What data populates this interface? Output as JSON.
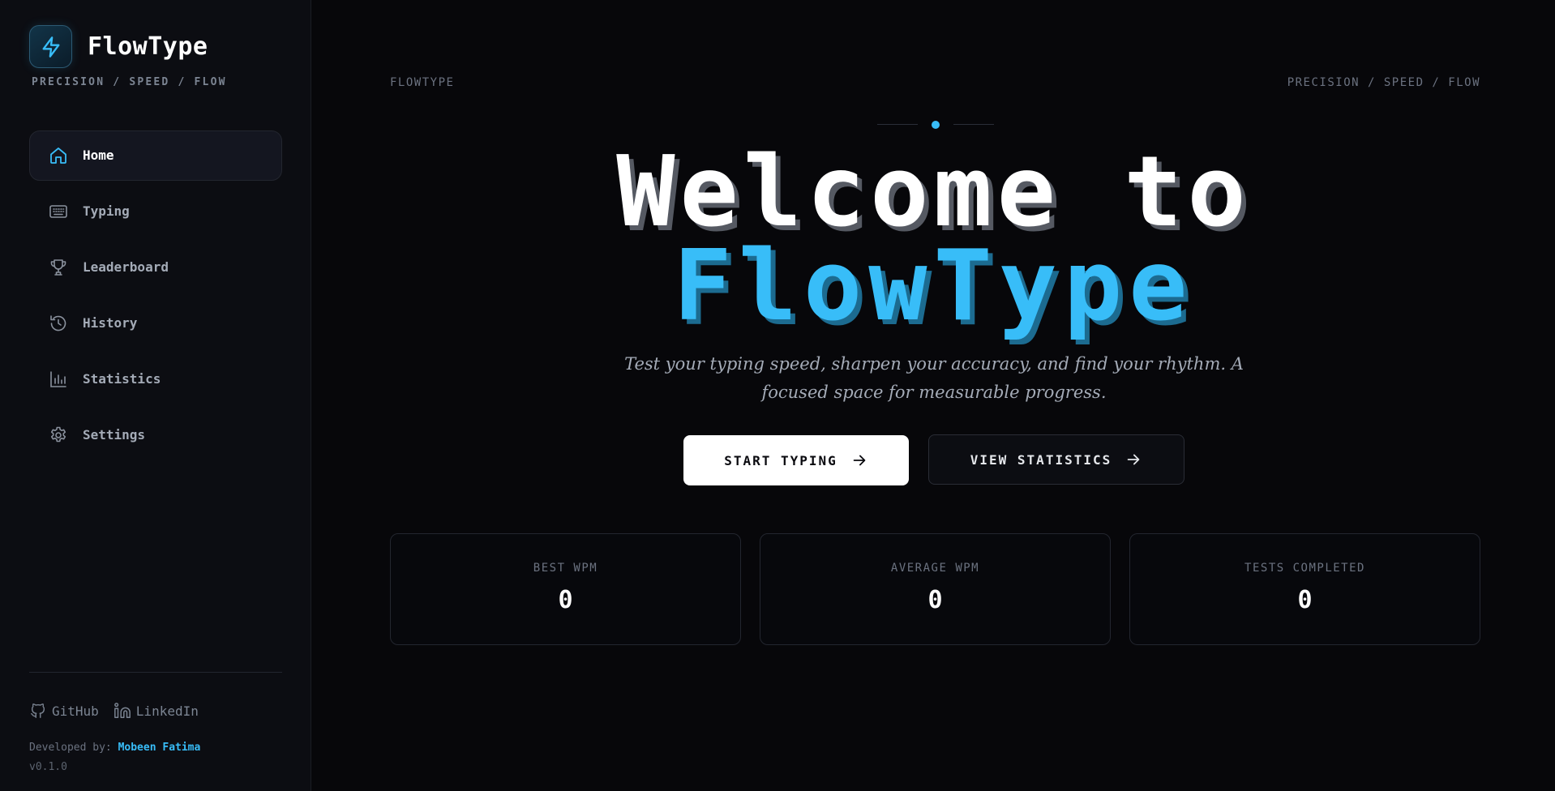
{
  "brand": {
    "name": "FlowType",
    "tagline": "PRECISION / SPEED / FLOW"
  },
  "sidebar": {
    "items": [
      {
        "label": "Home",
        "icon": "home-icon",
        "active": true
      },
      {
        "label": "Typing",
        "icon": "keyboard-icon",
        "active": false
      },
      {
        "label": "Leaderboard",
        "icon": "trophy-icon",
        "active": false
      },
      {
        "label": "History",
        "icon": "history-icon",
        "active": false
      },
      {
        "label": "Statistics",
        "icon": "bar-chart-icon",
        "active": false
      },
      {
        "label": "Settings",
        "icon": "gear-icon",
        "active": false
      }
    ],
    "socials": [
      {
        "label": "GitHub",
        "icon": "github-icon"
      },
      {
        "label": "LinkedIn",
        "icon": "linkedin-icon"
      }
    ],
    "developer_prefix": "Developed by:",
    "developer_name": "Mobeen Fatima",
    "version": "v0.1.0"
  },
  "main": {
    "top_left": "FLOWTYPE",
    "top_right": "PRECISION / SPEED / FLOW",
    "hero_line1": "Welcome to",
    "hero_line2": "FlowType",
    "subtitle": "Test your typing speed, sharpen your accuracy, and find your rhythm. A focused space for measurable progress.",
    "primary_button": "START TYPING",
    "secondary_button": "VIEW STATISTICS",
    "stats": [
      {
        "label": "BEST WPM",
        "value": "0"
      },
      {
        "label": "AVERAGE WPM",
        "value": "0"
      },
      {
        "label": "TESTS COMPLETED",
        "value": "0"
      }
    ]
  },
  "colors": {
    "accent": "#38bdf8",
    "background": "#07070a",
    "sidebar": "#0c0d12",
    "primary_button_bg": "#ffffff"
  }
}
